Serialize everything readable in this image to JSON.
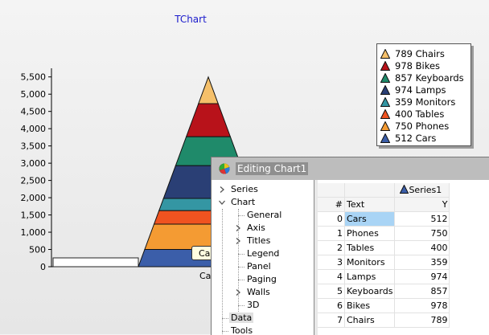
{
  "chart_data": {
    "type": "pyramid",
    "title": "TChart",
    "categories": [
      "Cars",
      "Phones",
      "Tables",
      "Monitors",
      "Lamps",
      "Keyboards",
      "Bikes",
      "Chairs"
    ],
    "values": [
      512,
      750,
      400,
      359,
      974,
      857,
      978,
      789
    ],
    "colors": [
      "#3b5ea9",
      "#f49b33",
      "#f05320",
      "#3496a3",
      "#2a3f75",
      "#1f8a6a",
      "#b8121a",
      "#f5c06a"
    ],
    "series": [
      {
        "name": "Series1"
      }
    ],
    "yticks": [
      0,
      500,
      1000,
      1500,
      2000,
      2500,
      3000,
      3500,
      4000,
      4500,
      5000,
      5500
    ],
    "ytick_labels": [
      "0",
      "500",
      "1,000",
      "1,500",
      "2,000",
      "2,500",
      "3,000",
      "3,500",
      "4,000",
      "4,500",
      "5,000",
      "5,500"
    ],
    "ylim": [
      0,
      5750
    ],
    "grid": false,
    "legend_position": "right",
    "legend": [
      "789 Chairs",
      "978 Bikes",
      "857 Keyboards",
      "974 Lamps",
      "359 Monitors",
      "400 Tables",
      "750 Phones",
      "512 Cars"
    ],
    "legend_colors": [
      "#f5c06a",
      "#b8121a",
      "#1f8a6a",
      "#2a3f75",
      "#3496a3",
      "#f05320",
      "#f49b33",
      "#3b5ea9"
    ],
    "x_tick_label": "Ca"
  },
  "tooltip": {
    "text": "Ca"
  },
  "dialog": {
    "title": "Editing Chart1",
    "tree": [
      {
        "label": "Series",
        "level": 0,
        "expander": "collapsed"
      },
      {
        "label": "Chart",
        "level": 0,
        "expander": "expanded"
      },
      {
        "label": "General",
        "level": 1,
        "expander": "none"
      },
      {
        "label": "Axis",
        "level": 1,
        "expander": "collapsed"
      },
      {
        "label": "Titles",
        "level": 1,
        "expander": "collapsed"
      },
      {
        "label": "Legend",
        "level": 1,
        "expander": "none"
      },
      {
        "label": "Panel",
        "level": 1,
        "expander": "none"
      },
      {
        "label": "Paging",
        "level": 1,
        "expander": "none"
      },
      {
        "label": "Walls",
        "level": 1,
        "expander": "collapsed"
      },
      {
        "label": "3D",
        "level": 1,
        "expander": "none"
      },
      {
        "label": "Data",
        "level": 0,
        "expander": "none",
        "selected": true
      },
      {
        "label": "Tools",
        "level": 0,
        "expander": "none"
      }
    ],
    "grid": {
      "series_header": "Series1",
      "columns": [
        "#",
        "Text",
        "Y"
      ],
      "rows": [
        {
          "index": "0",
          "text": "Cars",
          "y": "512"
        },
        {
          "index": "1",
          "text": "Phones",
          "y": "750"
        },
        {
          "index": "2",
          "text": "Tables",
          "y": "400"
        },
        {
          "index": "3",
          "text": "Monitors",
          "y": "359"
        },
        {
          "index": "4",
          "text": "Lamps",
          "y": "974"
        },
        {
          "index": "5",
          "text": "Keyboards",
          "y": "857"
        },
        {
          "index": "6",
          "text": "Bikes",
          "y": "978"
        },
        {
          "index": "7",
          "text": "Chairs",
          "y": "789"
        }
      ]
    }
  }
}
